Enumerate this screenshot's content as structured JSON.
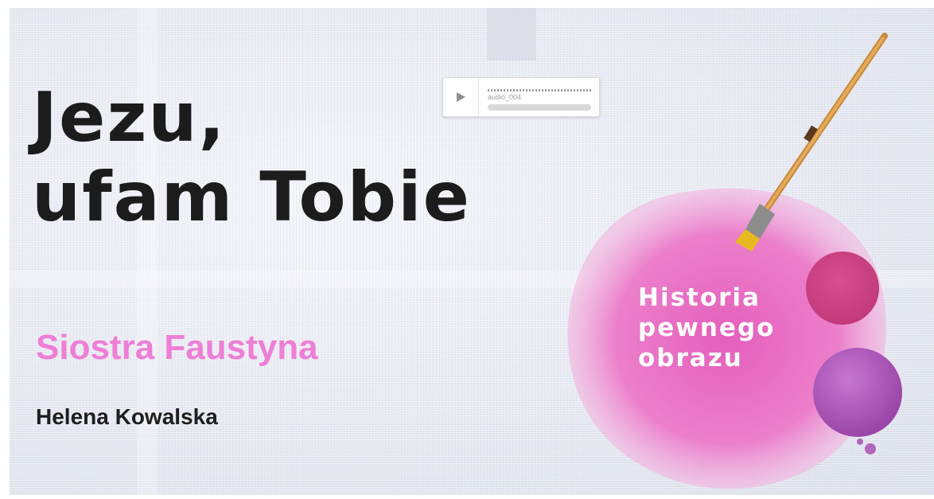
{
  "slide": {
    "title_line1": "Jezu,",
    "title_line2": "ufam Tobie",
    "subtitle": "Siostra Faustyna",
    "author": "Helena Kowalska",
    "badge_line1": "Historia",
    "badge_line2": "pewnego",
    "badge_line3": "obrazu"
  },
  "audio_player": {
    "filename": "audio_004",
    "play_icon": "play-icon"
  },
  "colors": {
    "title": "#1c1c1c",
    "subtitle": "#ee7ed6",
    "author": "#1e1e1e",
    "pink_paint": "#e66bc0",
    "plum_paint": "#b05ab8",
    "brush_handle": "#d9a050",
    "brush_bristles": "#e8b820"
  }
}
